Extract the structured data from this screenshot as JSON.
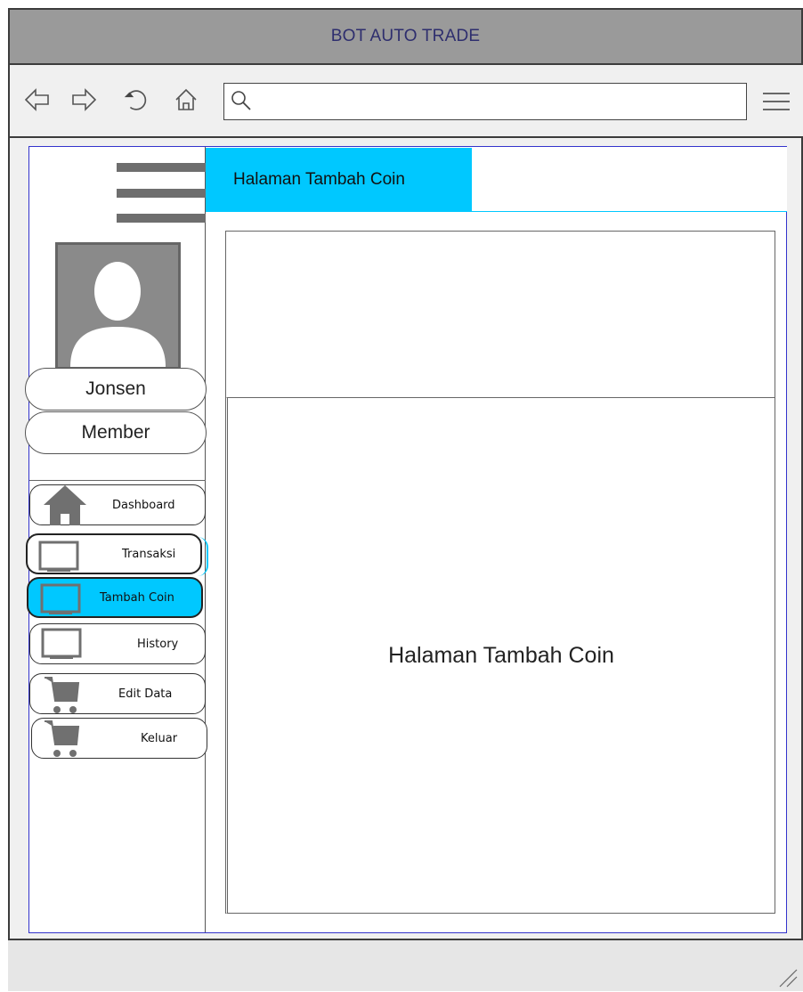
{
  "window": {
    "title": "BOT AUTO TRADE"
  },
  "toolbar": {
    "back_icon": "arrow-left-icon",
    "forward_icon": "arrow-right-icon",
    "reload_icon": "reload-icon",
    "home_icon": "home-icon",
    "search_icon": "search-icon",
    "menu_icon": "hamburger-menu-icon",
    "address_value": ""
  },
  "user": {
    "name": "Jonsen",
    "role": "Member"
  },
  "sidebar": {
    "items": [
      {
        "label": "Dashboard",
        "icon": "home-icon",
        "active": false
      },
      {
        "label": "Transaksi",
        "icon": "monitor-icon",
        "active": false
      },
      {
        "label": "Tambah Coin",
        "icon": "monitor-icon",
        "active": true
      },
      {
        "label": "History",
        "icon": "monitor-icon",
        "active": false
      },
      {
        "label": "Edit Data",
        "icon": "cart-icon",
        "active": false
      },
      {
        "label": "Keluar",
        "icon": "cart-icon",
        "active": false
      }
    ]
  },
  "header": {
    "title": "Halaman Tambah Coin"
  },
  "main": {
    "text": "Halaman Tambah Coin"
  },
  "colors": {
    "accent": "#00c8ff",
    "titlebar": "#9a9a9a",
    "frame_border": "#3333cc"
  }
}
